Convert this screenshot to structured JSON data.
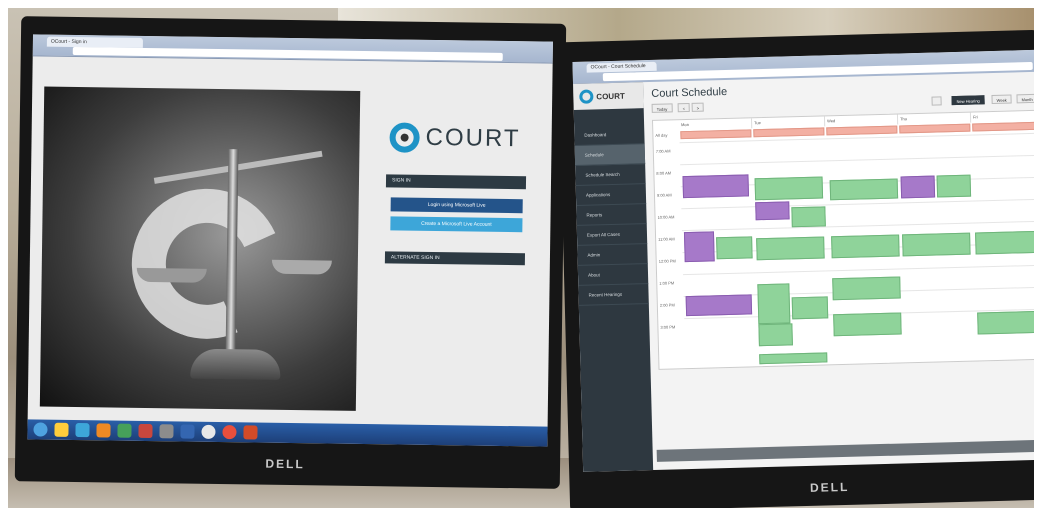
{
  "left_monitor": {
    "brand": "DELL",
    "browser_tab": "OCourt - Sign in",
    "logo_text": "COURT",
    "signin_header": "SIGN IN",
    "login_ms_button": "Login using Microsoft Live",
    "create_button": "Create a Microsoft Live Account",
    "alt_signin": "ALTERNATE SIGN IN"
  },
  "right_monitor": {
    "brand": "DELL",
    "browser_tab": "OCourt - Court Schedule",
    "logo_text": "COURT",
    "page_title": "Court Schedule",
    "toolbar": {
      "today": "Today",
      "prev": "<",
      "next": ">",
      "new_hearing": "New Hearing",
      "week": "Week",
      "month": "Month"
    },
    "sidebar": [
      {
        "label": "Dashboard",
        "icon": "dashboard-icon"
      },
      {
        "label": "Schedule",
        "icon": "calendar-icon"
      },
      {
        "label": "Schedule Search",
        "icon": "search-icon"
      },
      {
        "label": "Applications",
        "icon": "file-icon"
      },
      {
        "label": "Reports",
        "icon": "chart-icon"
      },
      {
        "label": "Export All Cases",
        "icon": "export-icon"
      },
      {
        "label": "Admin",
        "icon": "gear-icon"
      },
      {
        "label": "About",
        "icon": "info-icon"
      },
      {
        "label": "Recent Hearings",
        "icon": "clock-icon"
      }
    ],
    "day_headers": [
      "Mon",
      "Tue",
      "Wed",
      "Thu",
      "Fri"
    ],
    "times": [
      "All day",
      "7:00 AM",
      "8:00 AM",
      "9:00 AM",
      "10:00 AM",
      "11:00 AM",
      "12:00 PM",
      "1:00 PM",
      "2:00 PM",
      "3:00 PM"
    ]
  },
  "colors": {
    "accent": "#1e93c6",
    "sidebar": "#2e3840",
    "event_green": "#8fd39a",
    "event_purple": "#a679c9",
    "event_red": "#f3b0a3"
  }
}
